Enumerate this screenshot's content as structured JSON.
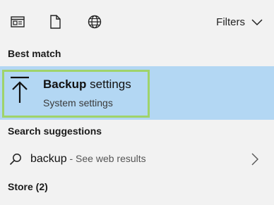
{
  "toolbar": {
    "icons": [
      "apps-icon",
      "documents-icon",
      "web-globe-icon"
    ],
    "filters_label": "Filters"
  },
  "sections": {
    "best_match": "Best match",
    "search_suggestions": "Search suggestions",
    "store": "Store (2)"
  },
  "best_match": {
    "title_bold": "Backup",
    "title_rest": " settings",
    "subtitle": "System settings",
    "icon": "upload-arrow-icon",
    "highlight_color": "#b3d7f3",
    "outline_color": "#9fd36a"
  },
  "suggestion": {
    "query": "backup",
    "hint": " - See web results",
    "icon": "search-icon"
  }
}
